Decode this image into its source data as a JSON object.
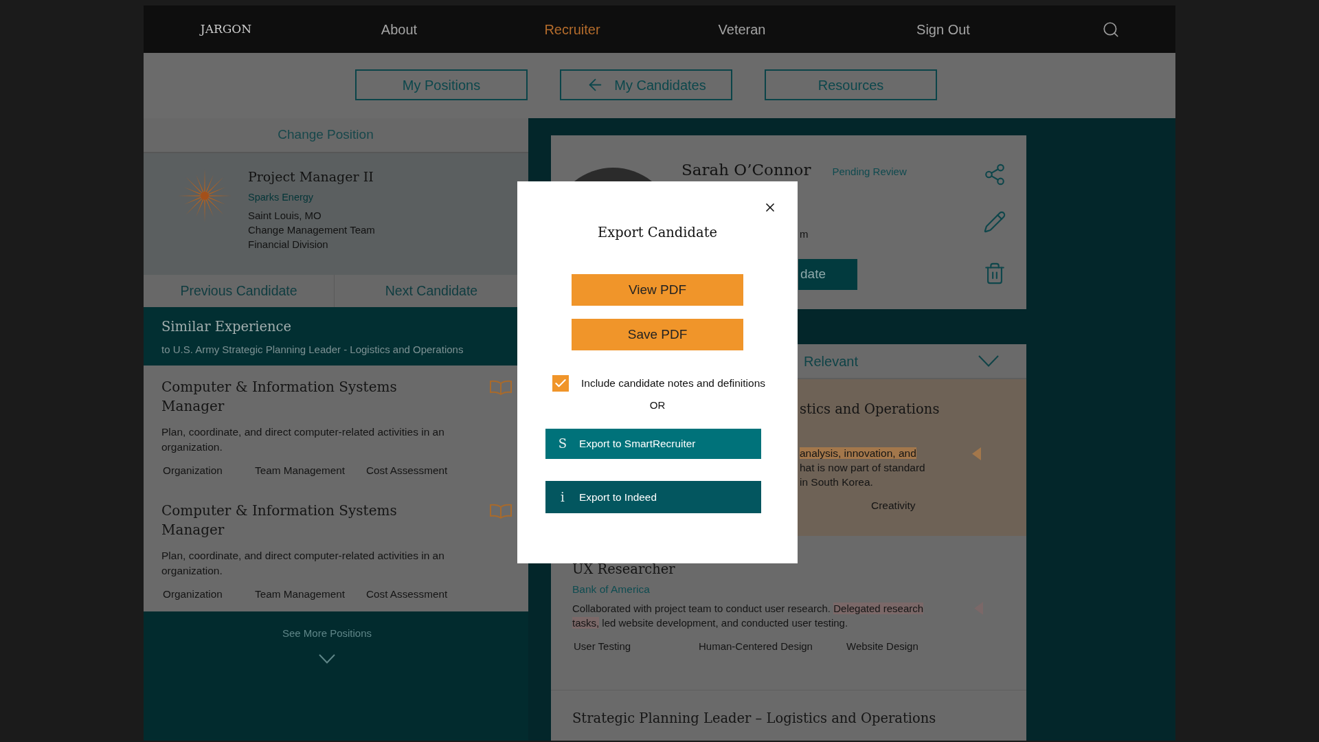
{
  "nav": {
    "logo": "JARGON",
    "items": [
      {
        "label": "About",
        "selected": false
      },
      {
        "label": "Recruiter",
        "selected": true
      },
      {
        "label": "Veteran",
        "selected": false
      },
      {
        "label": "Sign Out",
        "selected": false
      }
    ]
  },
  "subnav": [
    {
      "label": "My Positions",
      "kind": "plain"
    },
    {
      "label": "My Candidates",
      "kind": "back"
    },
    {
      "label": "Resources",
      "kind": "plain"
    }
  ],
  "position": {
    "header": "Change Position",
    "title": "Project Manager II",
    "company": "Sparks Energy",
    "details": [
      "Saint Louis, MO",
      "Change Management Team",
      "Financial Division"
    ],
    "previous": "Previous Candidate",
    "next": "Next Candidate"
  },
  "similar_experience": {
    "title": "Similar Experience",
    "subtitle": "to U.S. Army Strategic Planning Leader - Logistics and Operations",
    "positions": [
      {
        "title": "Computer & Information Systems Manager",
        "description": "Plan, coordinate, and direct computer-related activities in an organization.",
        "skills": [
          "Organization",
          "Team Management",
          "Cost Assessment"
        ]
      },
      {
        "title": "Computer & Information Systems Manager",
        "description": "Plan, coordinate, and direct computer-related activities in an organization.",
        "skills": [
          "Organization",
          "Team Management",
          "Cost Assessment"
        ]
      }
    ],
    "more": "See More Positions"
  },
  "candidate": {
    "name": "Sarah O’Connor",
    "status": "Pending Review",
    "detail": "m",
    "action": "date"
  },
  "experience": {
    "header": "Relevant",
    "items": [
      {
        "kind": "fragment",
        "selected": true,
        "color": "#a3774b",
        "title": "stics and Operations",
        "lines": [
          {
            "text": "analysis, innovation, and",
            "highlighted": true
          },
          {
            "text": "hat is now part of standard",
            "highlighted": false
          },
          {
            "text": "in South Korea.",
            "highlighted": false
          }
        ],
        "skills": [
          "Creativity"
        ]
      },
      {
        "kind": "entry",
        "selected": false,
        "color": "#7b6868",
        "title": "UX Researcher",
        "company": "Bank of America",
        "description": [
          {
            "text": "Collaborated with project team to conduct user research. ",
            "highlighted": false
          },
          {
            "text": "Delegated research tasks,",
            "highlighted": true
          },
          {
            "text": " led website development, and conducted user testing.",
            "highlighted": false
          }
        ],
        "skills": [
          "User Testing",
          "Human-Centered Design",
          "Website Design"
        ]
      },
      {
        "kind": "entry",
        "selected": false,
        "title": "Strategic Planning Leader – Logistics and Operations"
      }
    ]
  },
  "dialog": {
    "title": "Export Candidate",
    "buttons": [
      "View PDF",
      "Save PDF"
    ],
    "option": {
      "label": "Include candidate notes and definitions",
      "checked": true
    },
    "separator": "OR",
    "exports": [
      {
        "glyph": "S",
        "label": "Export to SmartRecruiter",
        "color": "#00727a"
      },
      {
        "glyph": "i",
        "label": "Export to Indeed",
        "color": "#03565f"
      }
    ]
  }
}
